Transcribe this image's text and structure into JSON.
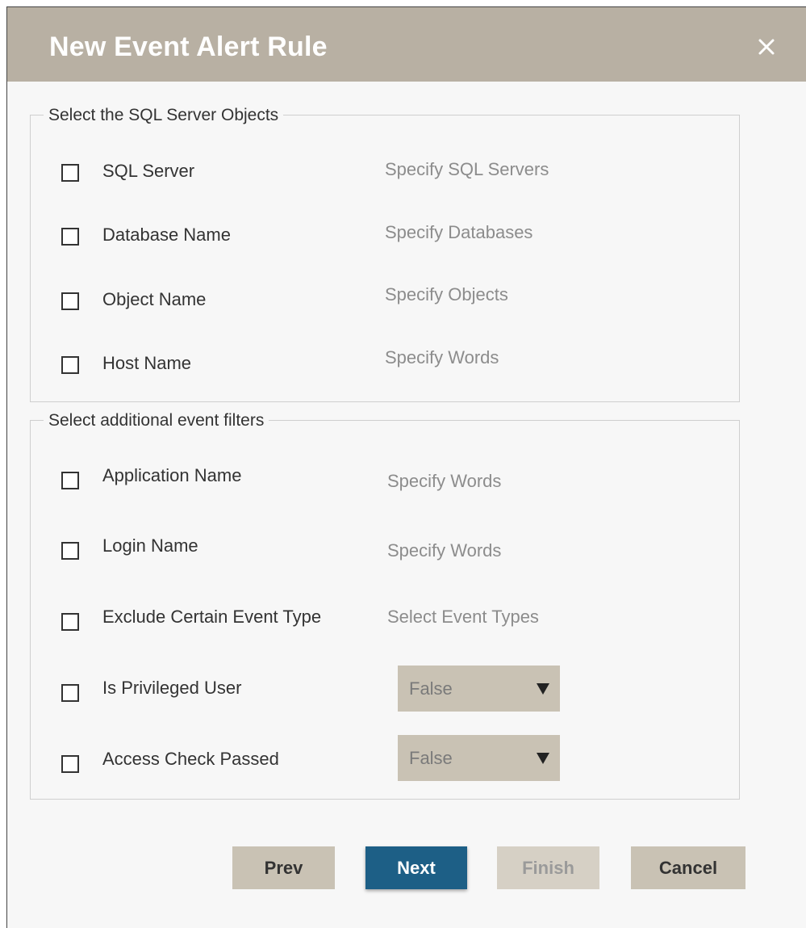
{
  "dialog": {
    "title": "New Event Alert Rule",
    "close_icon": "close-icon"
  },
  "sql_objects": {
    "legend": "Select the SQL Server Objects",
    "items": [
      {
        "label": "SQL Server",
        "action": "Specify SQL Servers",
        "checked": false
      },
      {
        "label": "Database Name",
        "action": "Specify Databases",
        "checked": false
      },
      {
        "label": "Object Name",
        "action": "Specify Objects",
        "checked": false
      },
      {
        "label": "Host Name",
        "action": "Specify Words",
        "checked": false
      }
    ]
  },
  "event_filters": {
    "legend": "Select additional event filters",
    "items": [
      {
        "label": "Application Name",
        "action": "Specify Words",
        "checked": false
      },
      {
        "label": "Login Name",
        "action": "Specify Words",
        "checked": false
      },
      {
        "label": "Exclude Certain Event Type",
        "action": "Select Event Types",
        "checked": false
      },
      {
        "label": "Is Privileged User",
        "select_value": "False",
        "checked": false
      },
      {
        "label": "Access Check Passed",
        "select_value": "False",
        "checked": false
      }
    ]
  },
  "buttons": {
    "prev": "Prev",
    "next": "Next",
    "finish": "Finish",
    "cancel": "Cancel"
  },
  "colors": {
    "titlebar": "#b8b0a3",
    "primary_button": "#1d5f86",
    "secondary_button": "#c9c2b4"
  }
}
